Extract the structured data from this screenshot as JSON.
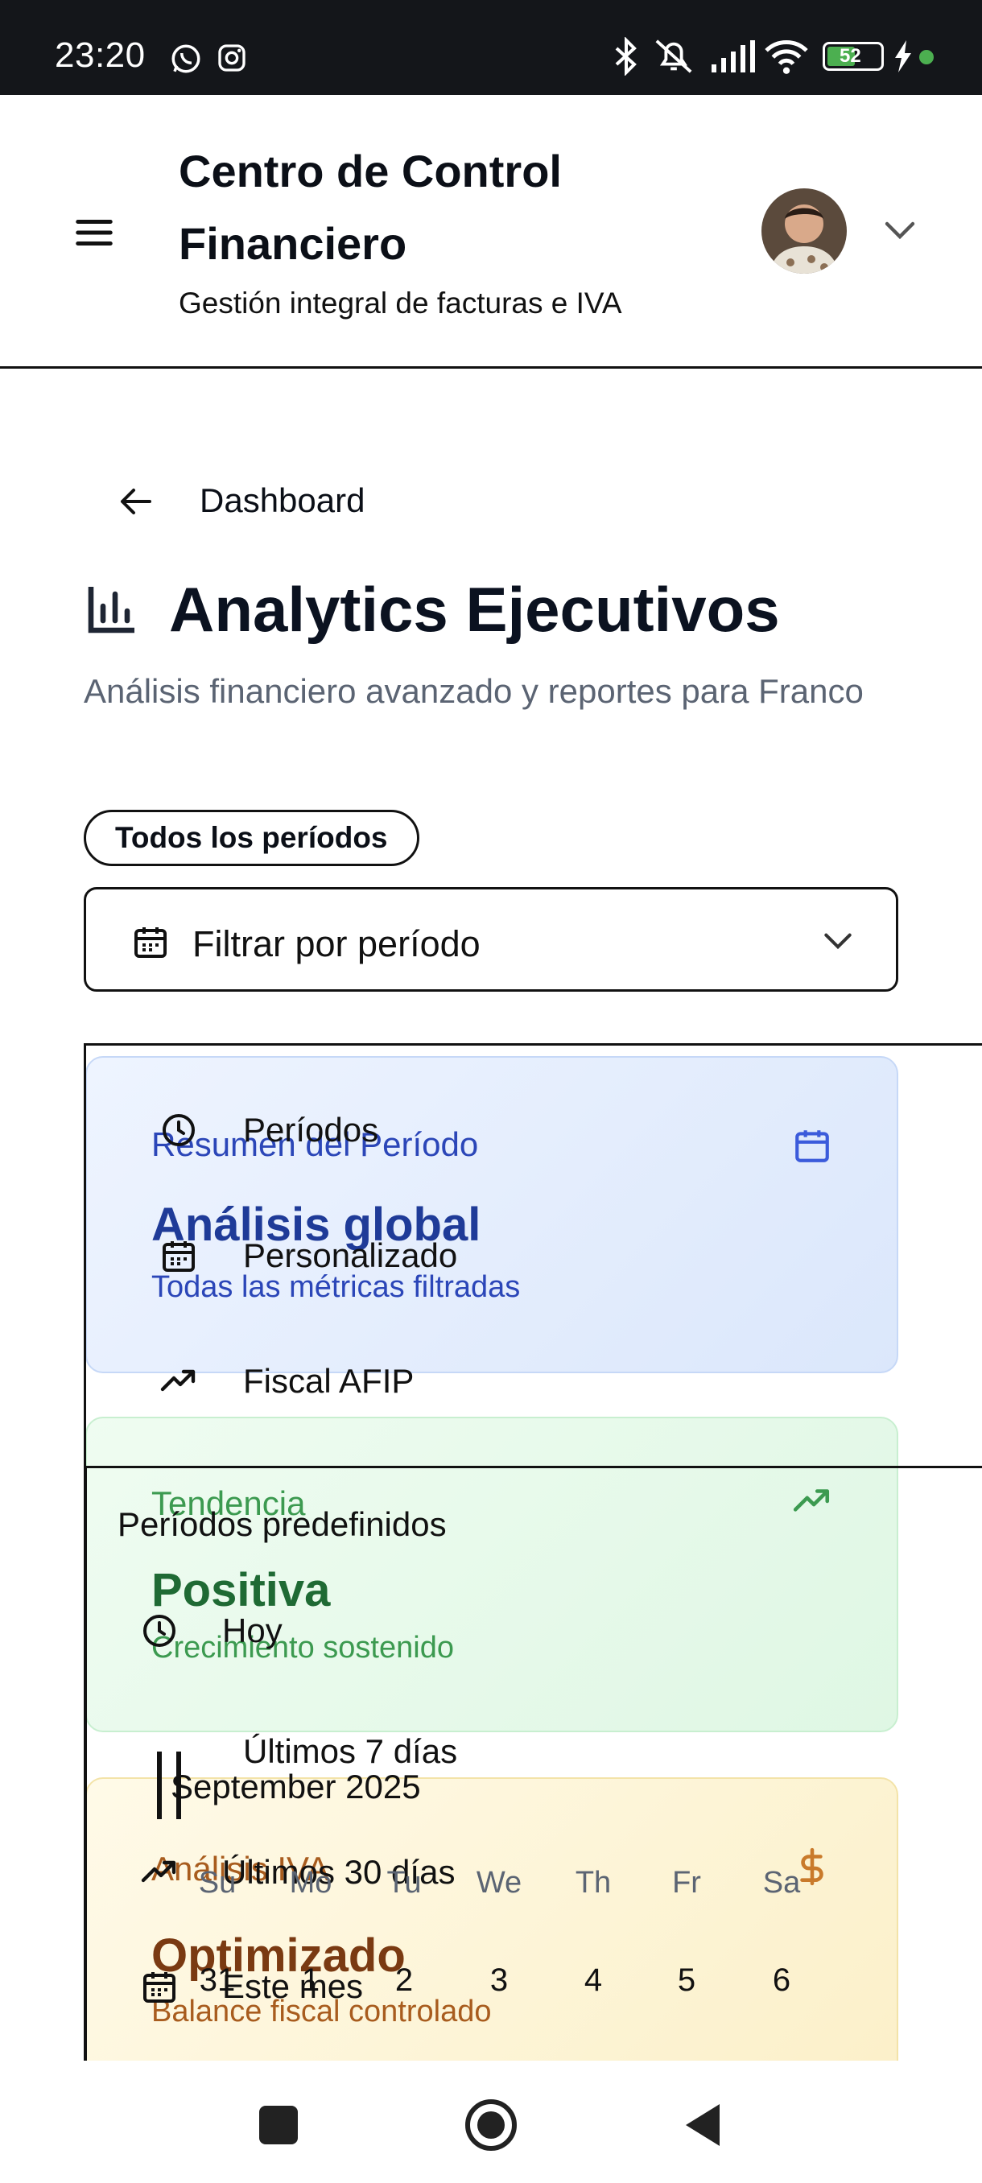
{
  "status_bar": {
    "time": "23:20",
    "battery": "52",
    "icons": [
      "whatsapp-icon",
      "instagram-icon",
      "bluetooth-icon",
      "mute-icon",
      "signal-icon",
      "wifi-icon",
      "battery-icon",
      "charging-icon"
    ]
  },
  "header": {
    "title": "Centro de Control Financiero",
    "subtitle": "Gestión integral de facturas e IVA"
  },
  "main": {
    "back_label": "Dashboard",
    "title": "Analytics Ejecutivos",
    "description": "Análisis financiero avanzado y reportes para Franco",
    "badge": "Todos los períodos",
    "filter_select": {
      "selected": "Filtrar por período"
    }
  },
  "cards": [
    {
      "label": "Resumen del Período",
      "value": "Análisis global",
      "sub": "Todas las métricas filtradas",
      "icon": "calendar-icon"
    },
    {
      "label": "Tendencia",
      "value": "Positiva",
      "sub": "Crecimiento sostenido",
      "icon": "trending-up-icon"
    },
    {
      "label": "Análisis IVA",
      "value": "Optimizado",
      "sub": "Balance fiscal controlado",
      "icon": "dollar-icon"
    }
  ],
  "dropdown": {
    "tabs": [
      {
        "label": "Períodos",
        "icon": "clock-icon"
      },
      {
        "label": "Personalizado",
        "icon": "calendar-icon"
      },
      {
        "label": "Fiscal AFIP",
        "icon": "trending-up-icon"
      }
    ],
    "section_title": "Períodos predefinidos",
    "options": [
      {
        "label": "Hoy",
        "icon": "clock-icon"
      },
      {
        "label": "Últimos 7 días",
        "icon": "bars-icon"
      },
      {
        "label": "Últimos 30 días",
        "icon": "trending-up-icon"
      },
      {
        "label": "Este mes",
        "icon": "calendar-icon"
      }
    ]
  },
  "calendar": {
    "month": "September 2025",
    "weekdays": [
      "Su",
      "Mo",
      "Tu",
      "We",
      "Th",
      "Fr",
      "Sa"
    ],
    "first_week": [
      "31",
      "1",
      "2",
      "3",
      "4",
      "5",
      "6"
    ]
  },
  "colors": {
    "card_blue": "#dbe7fb",
    "card_green": "#dff7e4",
    "card_amber": "#fbefc6",
    "status_bar": "#14161a",
    "battery_green": "#4caf50"
  }
}
